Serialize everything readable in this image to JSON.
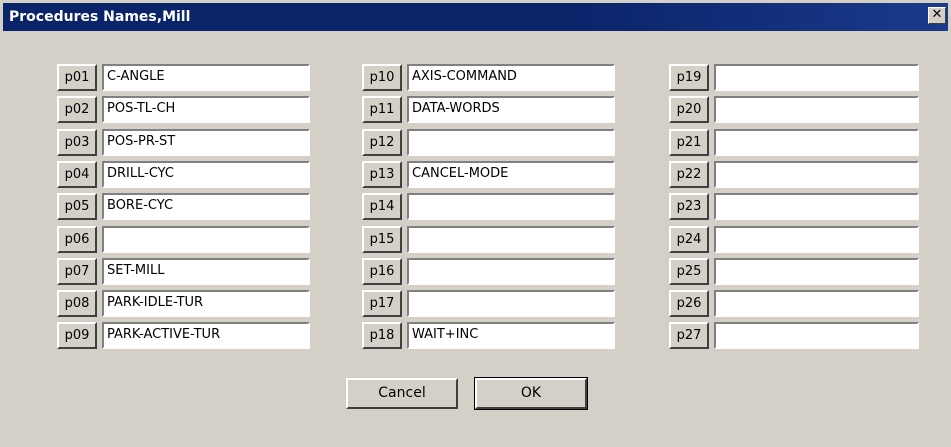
{
  "window": {
    "title": "Procedures Names,Mill",
    "close_glyph": "✕"
  },
  "columns": [
    {
      "rows": [
        {
          "label": "p01",
          "value": "C-ANGLE"
        },
        {
          "label": "p02",
          "value": "POS-TL-CH"
        },
        {
          "label": "p03",
          "value": "POS-PR-ST"
        },
        {
          "label": "p04",
          "value": "DRILL-CYC"
        },
        {
          "label": "p05",
          "value": "BORE-CYC"
        },
        {
          "label": "p06",
          "value": ""
        },
        {
          "label": "p07",
          "value": "SET-MILL"
        },
        {
          "label": "p08",
          "value": "PARK-IDLE-TUR"
        },
        {
          "label": "p09",
          "value": "PARK-ACTIVE-TUR"
        }
      ]
    },
    {
      "rows": [
        {
          "label": "p10",
          "value": "AXIS-COMMAND"
        },
        {
          "label": "p11",
          "value": "DATA-WORDS"
        },
        {
          "label": "p12",
          "value": ""
        },
        {
          "label": "p13",
          "value": "CANCEL-MODE"
        },
        {
          "label": "p14",
          "value": ""
        },
        {
          "label": "p15",
          "value": ""
        },
        {
          "label": "p16",
          "value": ""
        },
        {
          "label": "p17",
          "value": ""
        },
        {
          "label": "p18",
          "value": "WAIT+INC"
        }
      ]
    },
    {
      "rows": [
        {
          "label": "p19",
          "value": ""
        },
        {
          "label": "p20",
          "value": ""
        },
        {
          "label": "p21",
          "value": ""
        },
        {
          "label": "p22",
          "value": ""
        },
        {
          "label": "p23",
          "value": ""
        },
        {
          "label": "p24",
          "value": ""
        },
        {
          "label": "p25",
          "value": ""
        },
        {
          "label": "p26",
          "value": ""
        },
        {
          "label": "p27",
          "value": ""
        }
      ]
    }
  ],
  "buttons": {
    "cancel_label": "Cancel",
    "ok_label": "OK"
  },
  "colors": {
    "titlebar": "#0a246a",
    "face": "#d4d0c8"
  }
}
